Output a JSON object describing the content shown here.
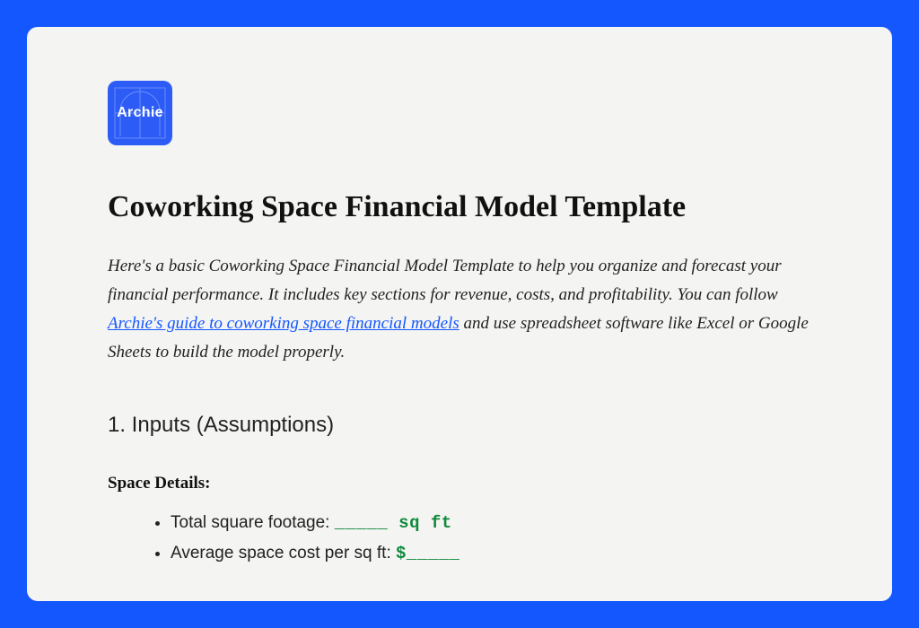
{
  "logo": {
    "text": "Archie"
  },
  "title": "Coworking Space Financial Model Template",
  "intro": {
    "part1": "Here's a basic Coworking Space Financial Model Template to help you organize and forecast your financial performance. It includes key sections for revenue, costs, and profitability. You can follow ",
    "link_text": "Archie's guide to coworking space financial models",
    "part2": " and use spreadsheet software like Excel or Google Sheets to build the model properly."
  },
  "section1": {
    "heading": "1. Inputs (Assumptions)",
    "sub1": {
      "label": "Space Details:",
      "items": [
        {
          "label": "Total square footage: ",
          "fill": "_____ sq ft"
        },
        {
          "label": "Average space cost per sq ft: ",
          "fill": "$_____"
        }
      ]
    }
  }
}
